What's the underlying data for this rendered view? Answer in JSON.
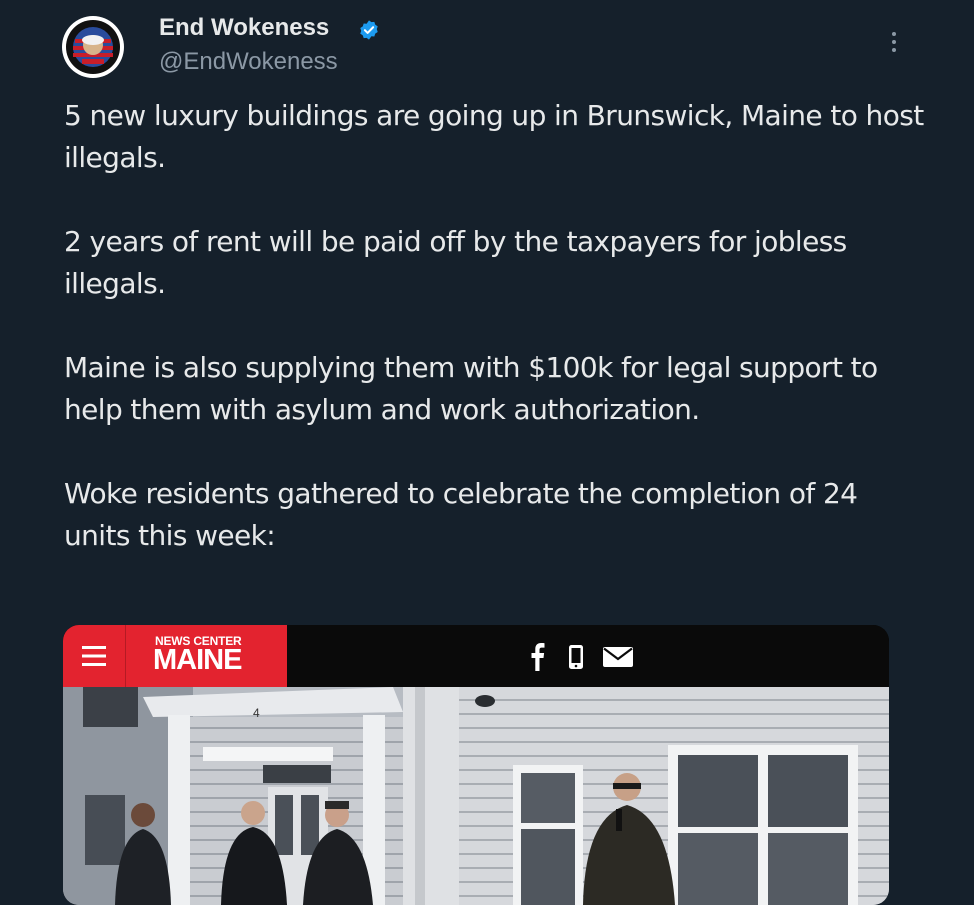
{
  "author": {
    "name": "End Wokeness",
    "handle": "@EndWokeness",
    "verified": true,
    "badge_color": "#1d9bf0"
  },
  "tweet": {
    "paragraphs": [
      "5 new luxury buildings are going up in Brunswick, Maine to host illegals.",
      "2 years of rent will be paid off by the taxpayers for jobless illegals.",
      "Maine is also supplying them with $100k for legal support to help them with asylum and work authorization.",
      "Woke residents gathered to celebrate the completion of 24 units this week:"
    ]
  },
  "media": {
    "brand_top": "NEWS CENTER",
    "brand_main": "MAINE",
    "brand_color": "#e3232f",
    "share_icons": [
      "facebook-icon",
      "phone-icon",
      "mail-icon"
    ],
    "building_number": "4"
  },
  "colors": {
    "background": "#15202b",
    "text": "#e7e9ea",
    "secondary_text": "#8b98a5"
  }
}
